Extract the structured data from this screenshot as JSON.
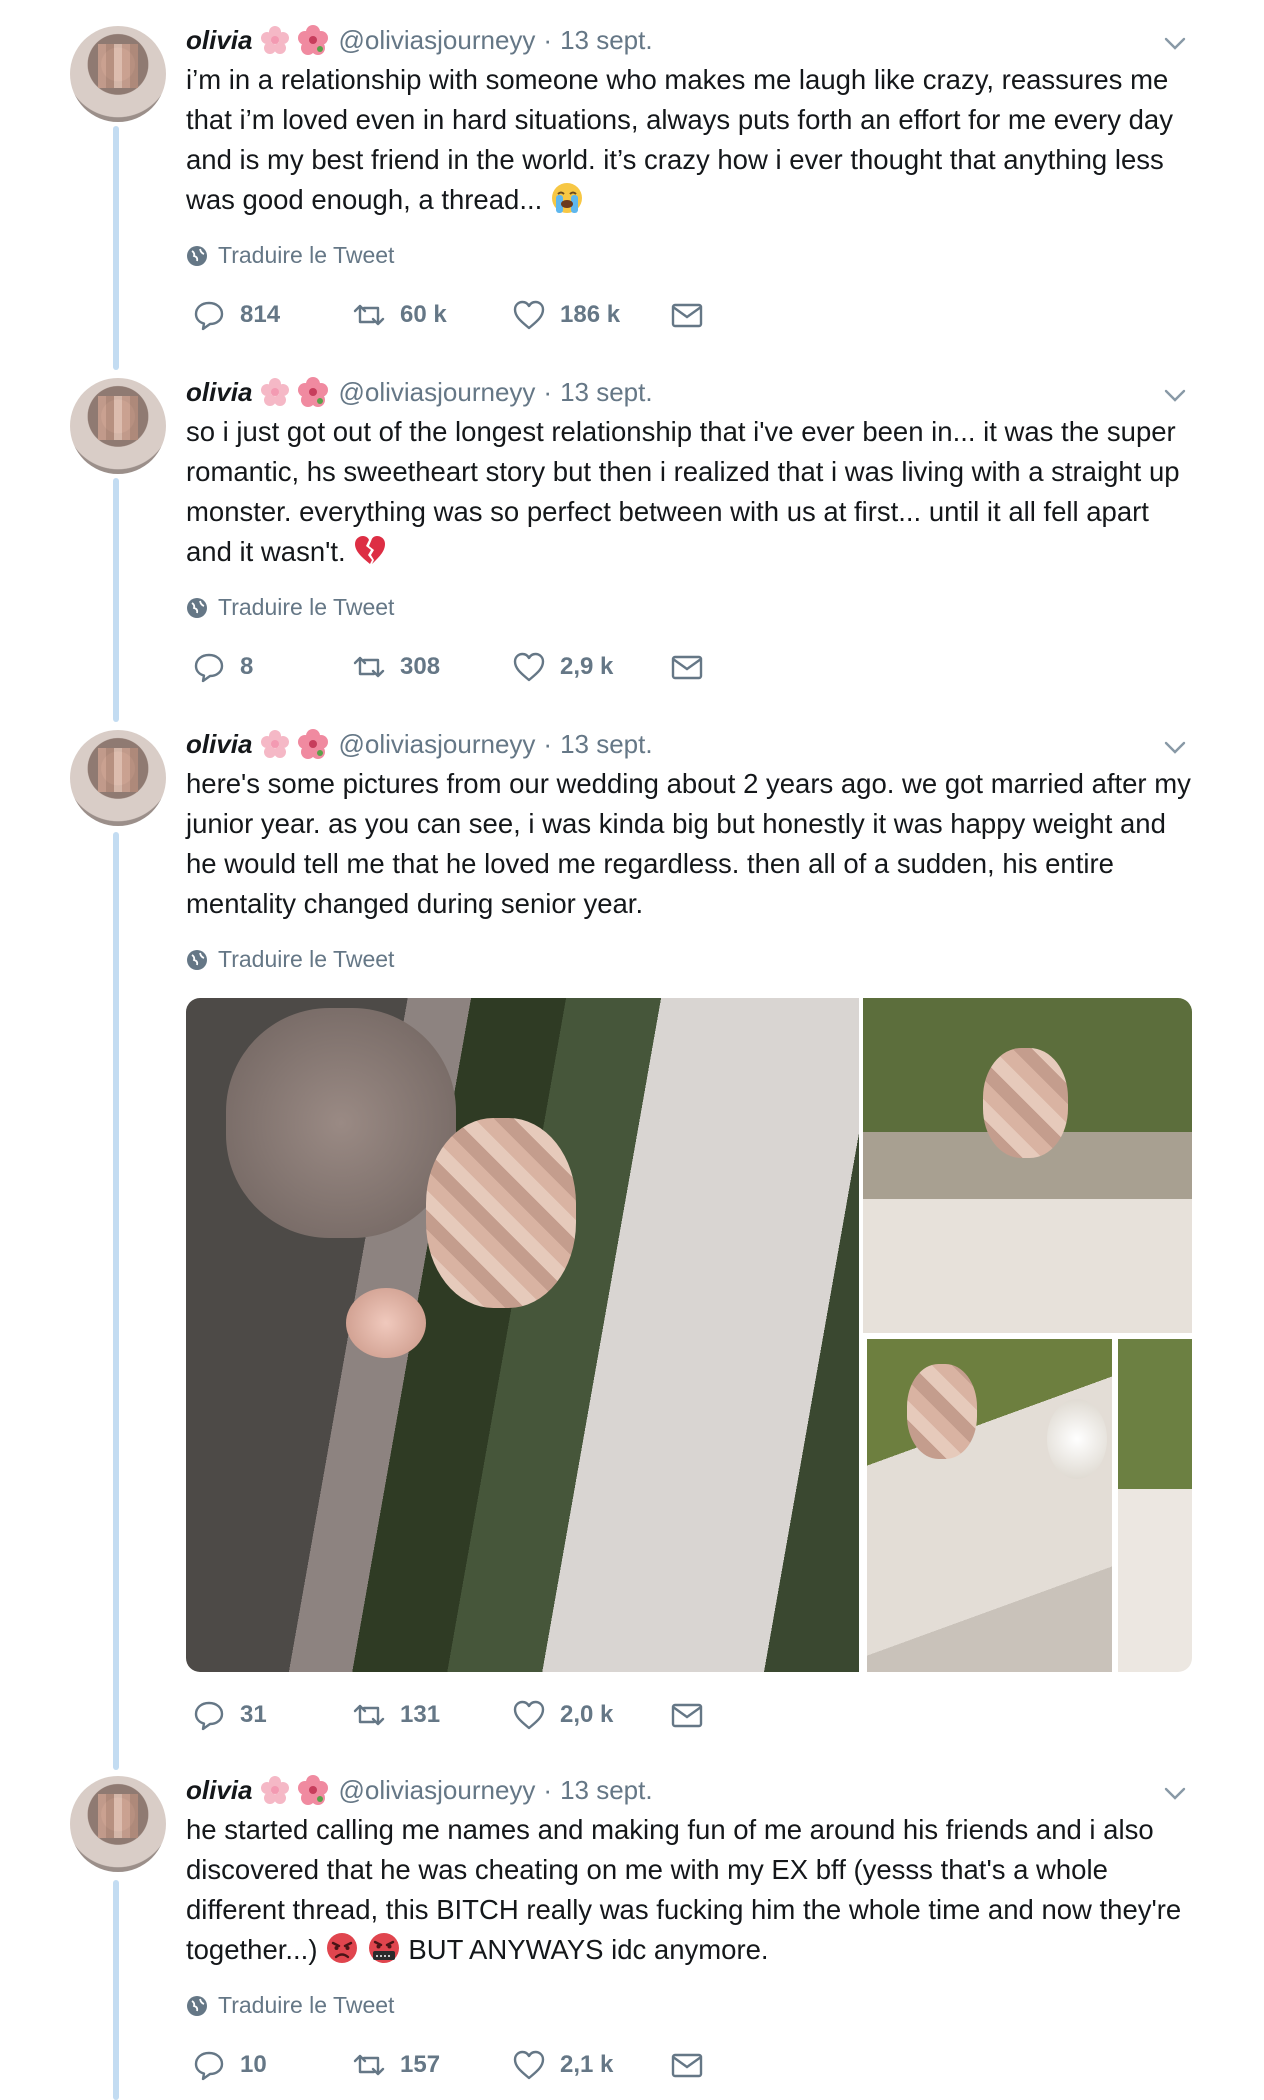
{
  "author": {
    "name": "olivia",
    "handle": "@oliviasjourneyy",
    "date": "13 sept."
  },
  "translate_label": "Traduire le Tweet",
  "tweets": [
    {
      "text_before_emoji": "i’m in a relationship with someone who makes me laugh like crazy, reassures me that i’m loved even in hard situations, always puts forth an effort for me every day and is my best friend in the world. it’s crazy how i ever thought that anything less was good enough, a thread...",
      "emojis": [
        "loudly-crying-face-emoji"
      ],
      "text_after_emoji": "",
      "replies": "814",
      "retweets": "60 k",
      "likes": "186 k"
    },
    {
      "text_before_emoji": "so i just got out of the longest relationship that i've ever been in... it was the super romantic, hs sweetheart story but then i realized that i was living with a straight up monster. everything was so perfect between with us at first... until it all fell apart and it wasn't.",
      "emojis": [
        "broken-heart-emoji"
      ],
      "text_after_emoji": "",
      "replies": "8",
      "retweets": "308",
      "likes": "2,9 k"
    },
    {
      "text_before_emoji": "here's some pictures from our wedding about 2 years ago. we got married after my junior year. as you can see, i was kinda big but honestly it was happy weight and he would tell me that he loved me regardless. then all of a sudden, his entire mentality changed during senior year.",
      "emojis": [],
      "text_after_emoji": "",
      "replies": "31",
      "retweets": "131",
      "likes": "2,0 k",
      "photos": [
        "wedding-photo-couple",
        "wedding-photo-bride-veil",
        "wedding-photo-bride-bouquet",
        "wedding-photo-bride-partial"
      ]
    },
    {
      "text_before_emoji": "he started calling me names and making fun of me around his friends and i also discovered that he was cheating on me with my EX bff (yesss that's a whole different thread, this BITCH really was fucking him the whole time and now they're together...)",
      "emojis": [
        "pouting-face-emoji",
        "face-with-symbols-emoji"
      ],
      "text_after_emoji": " BUT ANYWAYS idc anymore.",
      "replies": "10",
      "retweets": "157",
      "likes": "2,1 k"
    }
  ],
  "colors": {
    "thread_line": "#c3dcf2",
    "muted": "#657786",
    "text": "#14171a"
  }
}
